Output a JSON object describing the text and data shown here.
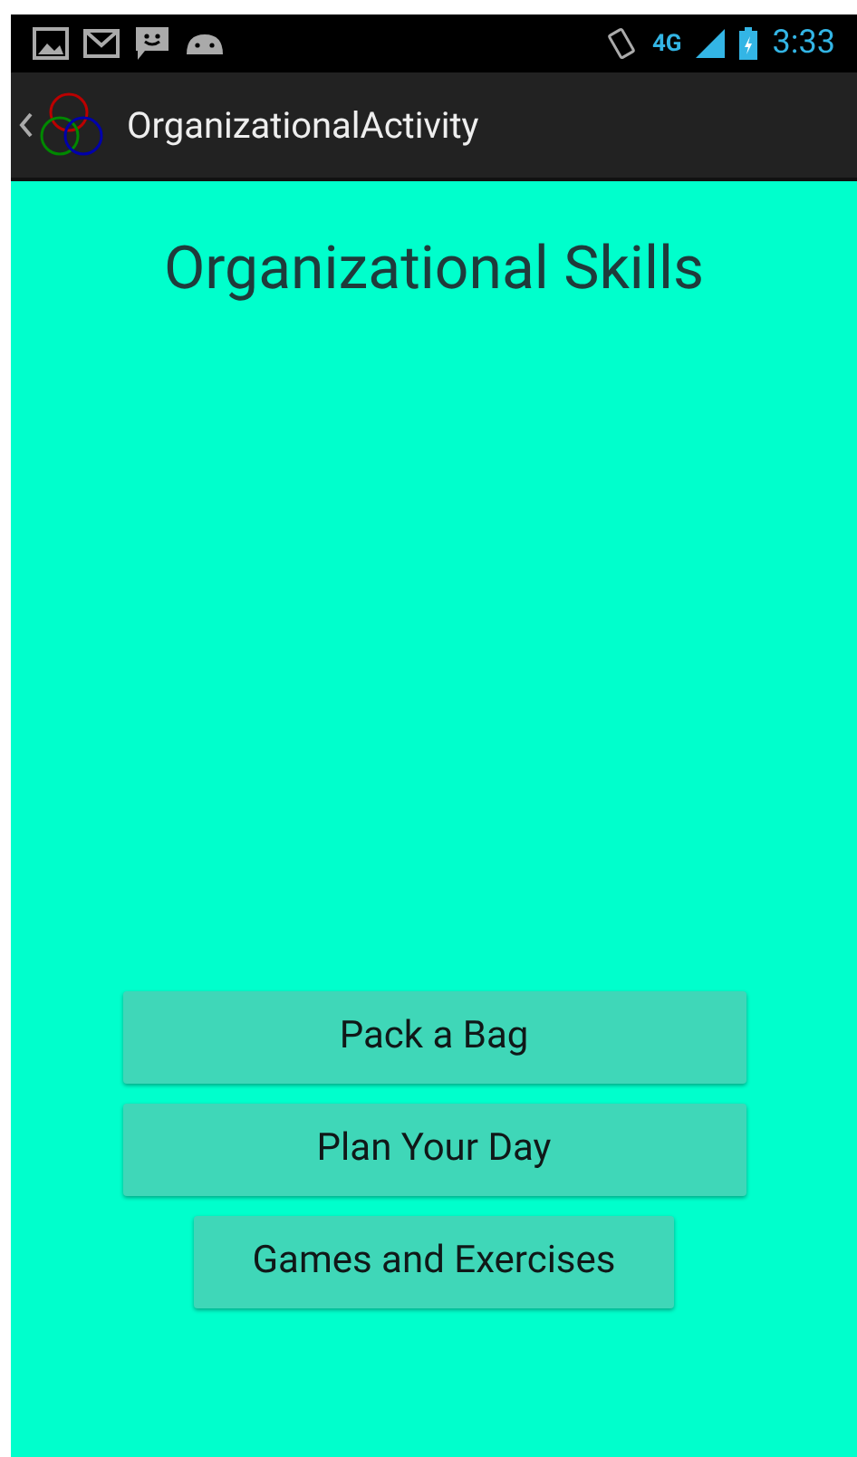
{
  "status_bar": {
    "time": "3:33",
    "network": "4G"
  },
  "action_bar": {
    "title": "OrganizationalActivity"
  },
  "heading": "Organizational Skills",
  "buttons": [
    {
      "label": "Pack a Bag",
      "kind": "fill"
    },
    {
      "label": "Plan Your Day",
      "kind": "fill"
    },
    {
      "label": "Games and Exercises",
      "kind": "wrap"
    }
  ]
}
